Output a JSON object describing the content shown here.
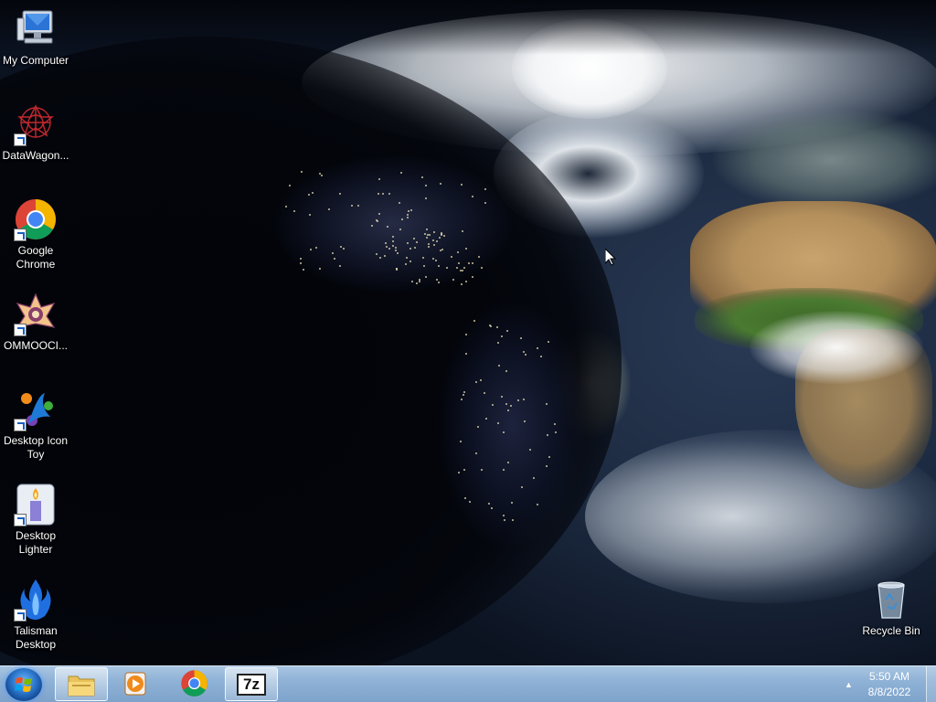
{
  "desktop": {
    "icons": [
      {
        "label": "My Computer",
        "icon": "computer-icon"
      },
      {
        "label": "DataWagon...",
        "icon": "datawagon-icon",
        "shortcut": true
      },
      {
        "label": "Google Chrome",
        "icon": "chrome-icon",
        "shortcut": true
      },
      {
        "label": "OMMOOCI...",
        "icon": "ommooci-icon",
        "shortcut": true
      },
      {
        "label": "Desktop Icon Toy",
        "icon": "desktop-icon-toy-icon",
        "shortcut": true
      },
      {
        "label": "Desktop Lighter",
        "icon": "candle-icon",
        "shortcut": true
      },
      {
        "label": "Talisman Desktop",
        "icon": "talisman-flame-icon",
        "shortcut": true
      },
      {
        "label": "Recycle Bin",
        "icon": "recycle-bin-icon"
      }
    ]
  },
  "taskbar": {
    "pinned": [
      {
        "name": "file-explorer",
        "icon": "folder-icon",
        "active": true
      },
      {
        "name": "media-player",
        "icon": "media-player-icon"
      },
      {
        "name": "chrome",
        "icon": "chrome-icon"
      },
      {
        "name": "7zip",
        "icon": "7zip-icon",
        "text": "7z"
      }
    ],
    "clock": {
      "time": "5:50 AM",
      "date": "8/8/2022"
    }
  },
  "colors": {
    "taskbar": "#8fb2d6",
    "label_text": "#ffffff"
  }
}
